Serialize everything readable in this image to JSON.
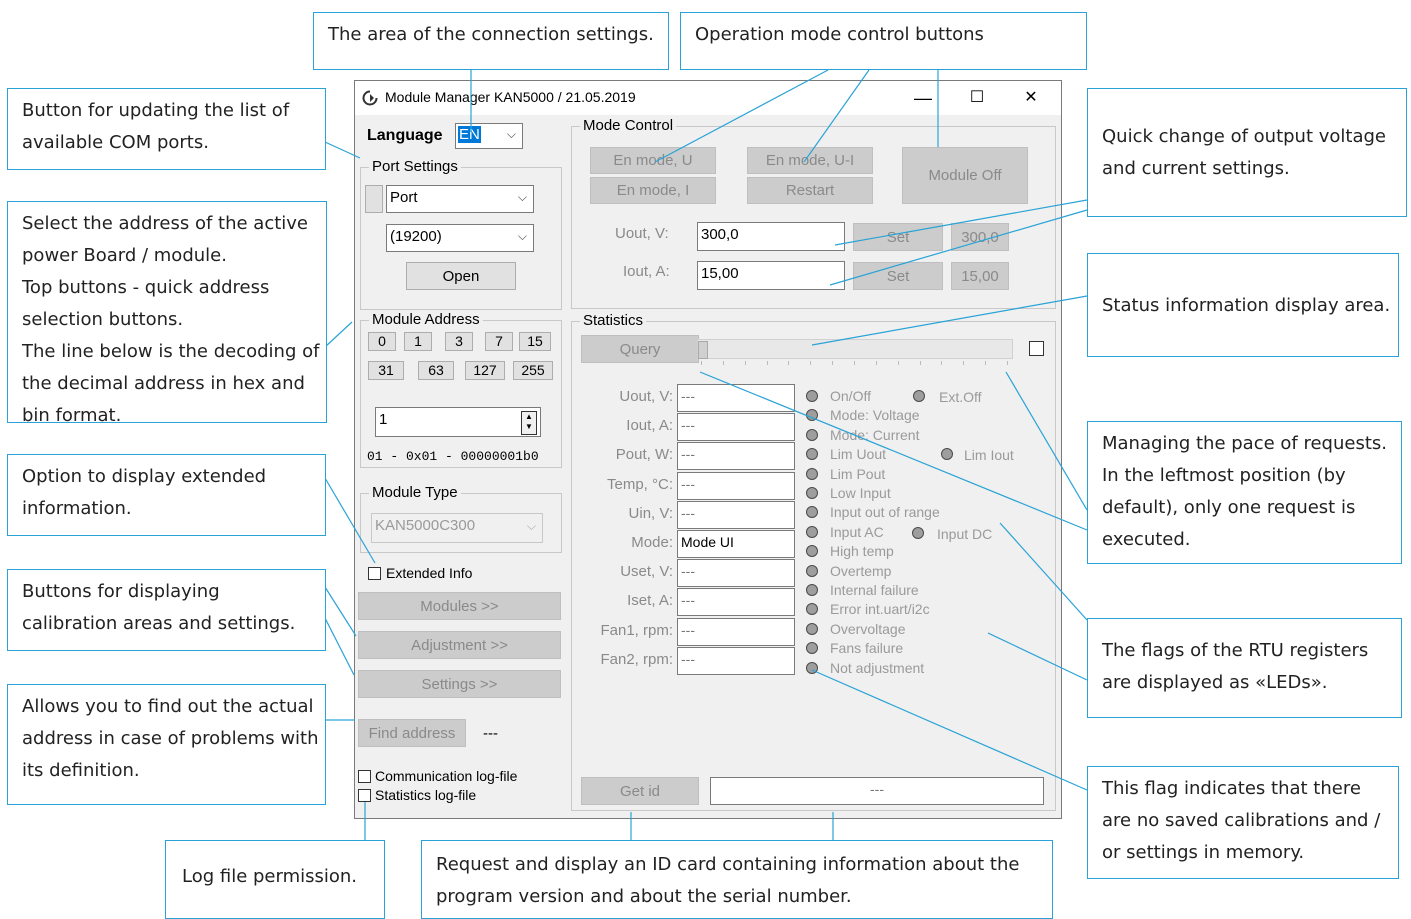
{
  "callouts": {
    "connection_area": "The area of the connection settings.",
    "operation_mode": "Operation mode control buttons",
    "update_ports": [
      "Button for updating the list of",
      "available COM ports."
    ],
    "select_address": [
      "Select the address of the active",
      "power Board / module.",
      "Top buttons - quick address",
      "selection buttons.",
      "The line below is the decoding of",
      "the decimal address in hex and",
      "bin format."
    ],
    "extended_info": [
      "Option to display extended",
      "information."
    ],
    "calibration_buttons": [
      "Buttons for displaying",
      "calibration areas and settings."
    ],
    "find_address": [
      "Allows you to find out the actual",
      "address in case of problems with",
      "its definition."
    ],
    "log_file": "Log file permission.",
    "request_id": [
      "Request and display an ID card containing information about the",
      "program version and about the serial number."
    ],
    "quick_change": [
      "Quick change of output voltage",
      "and current settings."
    ],
    "status_area": "Status information display area.",
    "request_pace": [
      "Managing the pace of requests.",
      "In the leftmost position (by",
      "default), only one request is",
      "executed."
    ],
    "rtu_flags": [
      "The flags of the RTU registers",
      "are displayed as «LEDs»."
    ],
    "no_calibration": [
      "This flag indicates that there",
      "are no saved calibrations and /",
      "or settings in memory."
    ]
  },
  "window": {
    "title": "Module Manager KAN5000 / 21.05.2019",
    "minimize": "—",
    "maximize": "☐",
    "close": "✕"
  },
  "language": {
    "label": "Language",
    "value": "EN"
  },
  "port_settings": {
    "label": "Port Settings",
    "port_value": "Port",
    "baud_value": "(19200)",
    "open_label": "Open"
  },
  "module_address": {
    "label": "Module Address",
    "quick_row1": [
      "0",
      "1",
      "3",
      "7",
      "15"
    ],
    "quick_row2": [
      "31",
      "63",
      "127",
      "255"
    ],
    "value": "1",
    "decoded": "01 - 0x01 - 00000001b0"
  },
  "module_type": {
    "label": "Module Type",
    "value": "KAN5000C300"
  },
  "extended_info_label": "Extended Info",
  "left_buttons": {
    "modules": "Modules >>",
    "adjustment": "Adjustment >>",
    "settings": "Settings >>"
  },
  "find_address": {
    "button": "Find address",
    "result": "---"
  },
  "logs": {
    "communication": "Communication log-file",
    "statistics": "Statistics log-file"
  },
  "mode_control": {
    "label": "Mode Control",
    "en_mode_u": "En mode, U",
    "en_mode_ui": "En mode, U-I",
    "module_off": "Module Off",
    "en_mode_i": "En mode, I",
    "restart": "Restart",
    "uout_label": "Uout, V:",
    "uout_value": "300,0",
    "uout_set": "Set",
    "uout_readback": "300,0",
    "iout_label": "Iout, A:",
    "iout_value": "15,00",
    "iout_set": "Set",
    "iout_readback": "15,00"
  },
  "statistics": {
    "label": "Statistics",
    "query": "Query",
    "pace_level": 0,
    "fields": [
      {
        "label": "Uout, V:",
        "value": "---"
      },
      {
        "label": "Iout, A:",
        "value": "---"
      },
      {
        "label": "Pout, W:",
        "value": "---"
      },
      {
        "label": "Temp, °C:",
        "value": "---"
      },
      {
        "label": "Uin, V:",
        "value": "---"
      },
      {
        "label": "Mode:",
        "value": "Mode UI"
      },
      {
        "label": "Uset, V:",
        "value": "---"
      },
      {
        "label": "Iset, A:",
        "value": "---"
      },
      {
        "label": "Fan1, rpm:",
        "value": "---"
      },
      {
        "label": "Fan2, rpm:",
        "value": "---"
      }
    ],
    "flags": [
      "On/Off",
      "Mode: Voltage",
      "Mode: Current",
      "Lim Uout",
      "Lim Pout",
      "Low Input",
      "Input out of range",
      "Input AC",
      "High temp",
      "Overtemp",
      "Internal failure",
      "Error int.uart/i2c",
      "Overvoltage",
      "Fans failure",
      "Not adjustment"
    ],
    "flags_extra": {
      "ext_off": "Ext.Off",
      "lim_iout": "Lim Iout",
      "input_dc": "Input DC"
    },
    "get_id": "Get id",
    "id_value": "---"
  },
  "colors": {
    "callout_border": "#29a3d6",
    "led": "#9e9e9e",
    "lang_highlight": "#0078d7"
  }
}
